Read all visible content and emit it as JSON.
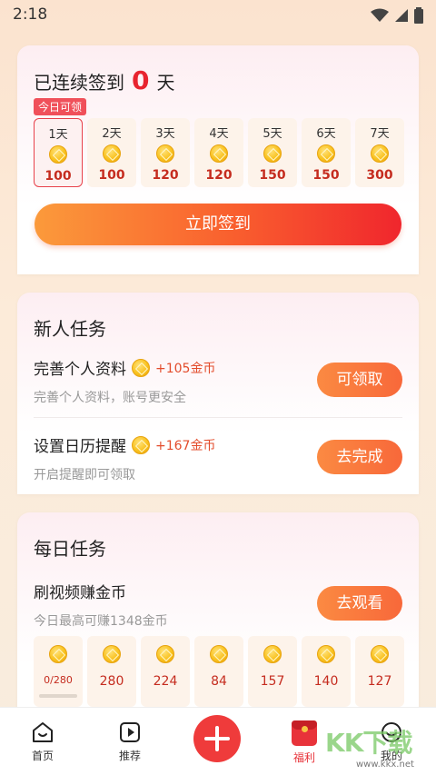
{
  "status": {
    "time": "2:18"
  },
  "signin": {
    "title_prefix": "已连续签到",
    "count": "0",
    "title_suffix": "天",
    "today_badge": "今日可领",
    "days": [
      {
        "label": "1天",
        "amount": "100",
        "active": true
      },
      {
        "label": "2天",
        "amount": "100",
        "active": false
      },
      {
        "label": "3天",
        "amount": "120",
        "active": false
      },
      {
        "label": "4天",
        "amount": "120",
        "active": false
      },
      {
        "label": "5天",
        "amount": "150",
        "active": false
      },
      {
        "label": "6天",
        "amount": "150",
        "active": false
      },
      {
        "label": "7天",
        "amount": "300",
        "active": false
      }
    ],
    "button_label": "立即签到"
  },
  "newbie": {
    "title": "新人任务",
    "tasks": [
      {
        "name": "完善个人资料",
        "reward": "+105金币",
        "desc": "完善个人资料，账号更安全",
        "button": "可领取"
      },
      {
        "name": "设置日历提醒",
        "reward": "+167金币",
        "desc": "开启提醒即可领取",
        "button": "去完成"
      }
    ]
  },
  "daily": {
    "title": "每日任务",
    "task": {
      "name": "刷视频赚金币",
      "desc": "今日最高可赚1348金币",
      "button": "去观看"
    },
    "progress": {
      "text": "0/280",
      "fraction": 0.0
    },
    "rewards": [
      "280",
      "224",
      "84",
      "157",
      "140",
      "127"
    ]
  },
  "nav": {
    "items": [
      {
        "label": "首页",
        "icon": "home-icon"
      },
      {
        "label": "推荐",
        "icon": "play-icon"
      },
      {
        "label": "",
        "icon": "plus-icon"
      },
      {
        "label": "福利",
        "icon": "red-envelope-icon"
      },
      {
        "label": "我的",
        "icon": "profile-icon"
      }
    ]
  },
  "watermark": {
    "text": "KK下载",
    "url": "www.kkx.net"
  },
  "colors": {
    "accent": "#f95e2e",
    "brand_red": "#e8242f",
    "reward_text": "#c52c1f"
  }
}
